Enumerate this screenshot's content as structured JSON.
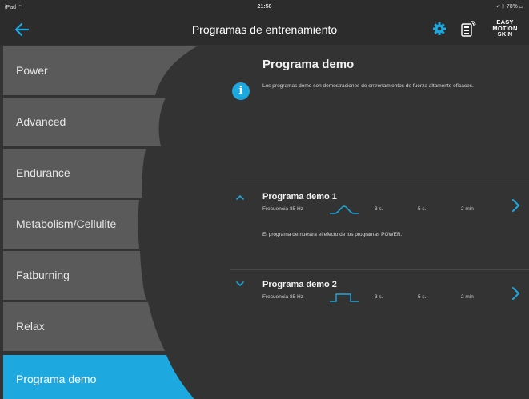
{
  "status": {
    "device": "iPad",
    "time": "21:58",
    "battery": "78%"
  },
  "header": {
    "title": "Programas de entrenamiento",
    "logo": [
      "EASY",
      "MOTION",
      "SKIN"
    ]
  },
  "sidebar": {
    "items": [
      {
        "label": "Power",
        "active": false
      },
      {
        "label": "Advanced",
        "active": false
      },
      {
        "label": "Endurance",
        "active": false
      },
      {
        "label": "Metabolism/Cellulite",
        "active": false
      },
      {
        "label": "Fatburning",
        "active": false
      },
      {
        "label": "Relax",
        "active": false
      },
      {
        "label": "Programa demo",
        "active": true
      }
    ]
  },
  "main": {
    "title": "Programa demo",
    "description": "Los programas demo son demostraciones de entrenamientos de fuerza altamente eficaces.",
    "programs": [
      {
        "name": "Programa demo 1",
        "frequency": "Frecuencia 85 Hz",
        "t1": "3 s.",
        "t2": "5 s.",
        "t3": "2 min",
        "expanded": true,
        "wave": "sine",
        "description": "El programa demuestra el efecto de los programas POWER."
      },
      {
        "name": "Programa demo 2",
        "frequency": "Frecuencia 85 Hz",
        "t1": "3 s.",
        "t2": "5 s.",
        "t3": "2 min",
        "expanded": false,
        "wave": "square",
        "description": ""
      }
    ]
  },
  "colors": {
    "accent": "#1ea8e0",
    "background": "#333333",
    "sidebar_button": "#5a5a5a",
    "header": "#2c2c2c"
  },
  "icons": {
    "back": "arrow-left-icon",
    "settings": "gear-icon",
    "device": "device-icon",
    "info": "info-icon",
    "expand": "chevron-up-icon",
    "collapse": "chevron-down-icon",
    "open": "chevron-right-icon"
  }
}
